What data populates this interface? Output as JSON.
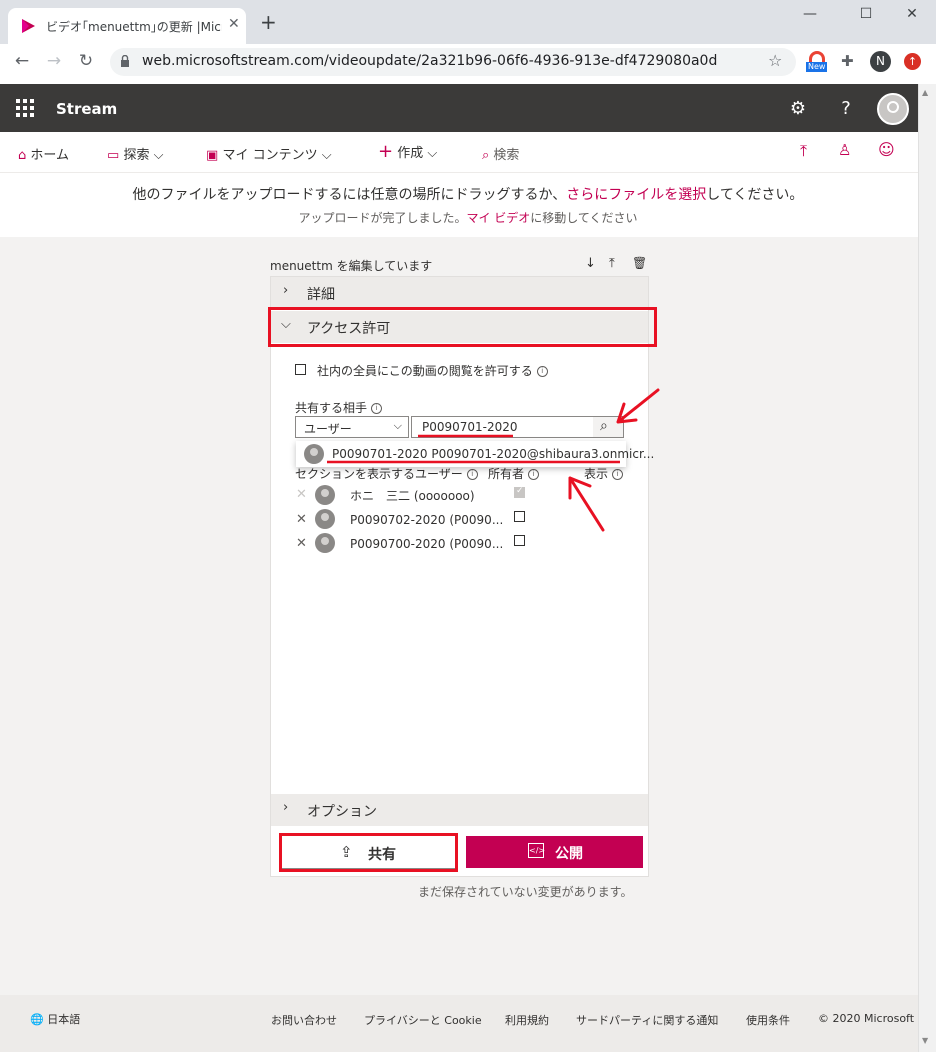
{
  "browser": {
    "tab_title": "ビデオ｢menuettm｣の更新 |Microso",
    "url": "web.microsoftstream.com/videoupdate/2a321b96-06f6-4936-913e-df4729080a0d",
    "profile_initial": "N",
    "ext_badge": "New"
  },
  "header": {
    "app_name": "Stream"
  },
  "nav": {
    "home": "ホーム",
    "explore": "探索",
    "my_content": "マイ コンテンツ",
    "create": "作成",
    "search": "検索"
  },
  "upload": {
    "line1_prefix": "他のファイルをアップロードするには任意の場所にドラッグするか、",
    "line1_link": "さらにファイルを選択",
    "line1_suffix": "してください。",
    "line2_prefix": "アップロードが完了しました。",
    "line2_link": "マイ ビデオ",
    "line2_suffix": "に移動してください"
  },
  "editor": {
    "title": "menuettm を編集しています",
    "sections": {
      "details": "詳細",
      "access": "アクセス許可",
      "options": "オプション"
    },
    "allow_company": "社内の全員にこの動画の閲覧を許可する",
    "share_with": "共有する相手",
    "type_select": "ユーザー",
    "search_value": "P0090701-2020",
    "suggestion": "P0090701-2020 P0090701-2020@shibaura3.onmicr...",
    "col_users": "セクションを表示するユーザー",
    "col_owner": "所有者",
    "col_display": "表示",
    "rows": [
      {
        "name": "ホニ　三二 (ooooooo)",
        "owner": true,
        "display": false
      },
      {
        "name": "P0090702-2020 (P0090...",
        "owner": false,
        "display": false
      },
      {
        "name": "P0090700-2020 (P0090...",
        "owner": false,
        "display": false
      }
    ],
    "share_button": "共有",
    "publish_button": "公開",
    "unsaved_message": "まだ保存されていない変更があります。"
  },
  "footer": {
    "language": "日本語",
    "contact": "お問い合わせ",
    "privacy": "プライバシーと Cookie",
    "terms": "利用規約",
    "third_party": "サードパーティに関する通知",
    "usage": "使用条件",
    "copyright": "© 2020 Microsoft"
  },
  "colors": {
    "accent": "#c30052",
    "annotation": "#e81123",
    "suitebar": "#3b3a39"
  }
}
